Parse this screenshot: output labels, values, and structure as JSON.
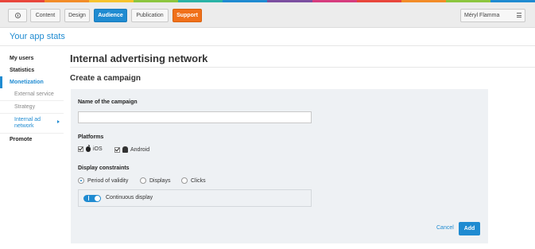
{
  "colors": {
    "accent": "#1f8bd1",
    "support": "#f0701a",
    "rainbow": [
      "#e8463c",
      "#f28c28",
      "#f6c32c",
      "#8cc63f",
      "#2ab3a6",
      "#1f8bd1",
      "#7b4fa0",
      "#d63c7e",
      "#e8463c",
      "#f28c28",
      "#8cc63f",
      "#1f8bd1"
    ]
  },
  "topnav": {
    "home_icon": "home-icon",
    "tabs": [
      {
        "label": "Content"
      },
      {
        "label": "Design"
      },
      {
        "label": "Audience"
      },
      {
        "label": "Publication"
      },
      {
        "label": "Support"
      }
    ],
    "user_name": "Méryl Flamma",
    "menu_icon": "hamburger-menu-icon"
  },
  "app": {
    "title": "Your app stats"
  },
  "sidebar": {
    "items": [
      {
        "label": "My users"
      },
      {
        "label": "Statistics"
      },
      {
        "label": "Monetization"
      },
      {
        "label": "External service"
      },
      {
        "label": "Strategy"
      },
      {
        "label": "Internal ad network"
      },
      {
        "label": "Promote"
      }
    ]
  },
  "page": {
    "title": "Internal advertising network",
    "section_title": "Create a campaign"
  },
  "form": {
    "campaign_name_label": "Name of the campaign",
    "campaign_name_value": "",
    "platforms_label": "Platforms",
    "platforms": [
      {
        "label": "iOS",
        "checked": true,
        "icon": "apple-icon"
      },
      {
        "label": "Android",
        "checked": true,
        "icon": "android-icon"
      }
    ],
    "constraints_label": "Display constraints",
    "constraints": [
      {
        "label": "Period of validity",
        "selected": true
      },
      {
        "label": "Displays",
        "selected": false
      },
      {
        "label": "Clicks",
        "selected": false
      }
    ],
    "continuous_display_label": "Continuous display",
    "continuous_display_on": true,
    "cancel_label": "Cancel",
    "add_label": "Add"
  }
}
